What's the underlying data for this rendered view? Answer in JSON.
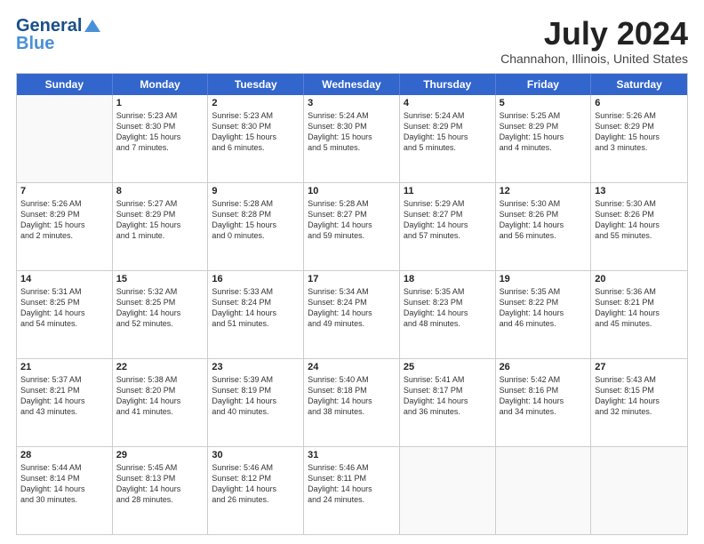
{
  "header": {
    "logo_line1": "General",
    "logo_line2": "Blue",
    "month": "July 2024",
    "location": "Channahon, Illinois, United States"
  },
  "days_of_week": [
    "Sunday",
    "Monday",
    "Tuesday",
    "Wednesday",
    "Thursday",
    "Friday",
    "Saturday"
  ],
  "weeks": [
    [
      {
        "day": "",
        "lines": []
      },
      {
        "day": "1",
        "lines": [
          "Sunrise: 5:23 AM",
          "Sunset: 8:30 PM",
          "Daylight: 15 hours",
          "and 7 minutes."
        ]
      },
      {
        "day": "2",
        "lines": [
          "Sunrise: 5:23 AM",
          "Sunset: 8:30 PM",
          "Daylight: 15 hours",
          "and 6 minutes."
        ]
      },
      {
        "day": "3",
        "lines": [
          "Sunrise: 5:24 AM",
          "Sunset: 8:30 PM",
          "Daylight: 15 hours",
          "and 5 minutes."
        ]
      },
      {
        "day": "4",
        "lines": [
          "Sunrise: 5:24 AM",
          "Sunset: 8:29 PM",
          "Daylight: 15 hours",
          "and 5 minutes."
        ]
      },
      {
        "day": "5",
        "lines": [
          "Sunrise: 5:25 AM",
          "Sunset: 8:29 PM",
          "Daylight: 15 hours",
          "and 4 minutes."
        ]
      },
      {
        "day": "6",
        "lines": [
          "Sunrise: 5:26 AM",
          "Sunset: 8:29 PM",
          "Daylight: 15 hours",
          "and 3 minutes."
        ]
      }
    ],
    [
      {
        "day": "7",
        "lines": [
          "Sunrise: 5:26 AM",
          "Sunset: 8:29 PM",
          "Daylight: 15 hours",
          "and 2 minutes."
        ]
      },
      {
        "day": "8",
        "lines": [
          "Sunrise: 5:27 AM",
          "Sunset: 8:29 PM",
          "Daylight: 15 hours",
          "and 1 minute."
        ]
      },
      {
        "day": "9",
        "lines": [
          "Sunrise: 5:28 AM",
          "Sunset: 8:28 PM",
          "Daylight: 15 hours",
          "and 0 minutes."
        ]
      },
      {
        "day": "10",
        "lines": [
          "Sunrise: 5:28 AM",
          "Sunset: 8:27 PM",
          "Daylight: 14 hours",
          "and 59 minutes."
        ]
      },
      {
        "day": "11",
        "lines": [
          "Sunrise: 5:29 AM",
          "Sunset: 8:27 PM",
          "Daylight: 14 hours",
          "and 57 minutes."
        ]
      },
      {
        "day": "12",
        "lines": [
          "Sunrise: 5:30 AM",
          "Sunset: 8:26 PM",
          "Daylight: 14 hours",
          "and 56 minutes."
        ]
      },
      {
        "day": "13",
        "lines": [
          "Sunrise: 5:30 AM",
          "Sunset: 8:26 PM",
          "Daylight: 14 hours",
          "and 55 minutes."
        ]
      }
    ],
    [
      {
        "day": "14",
        "lines": [
          "Sunrise: 5:31 AM",
          "Sunset: 8:25 PM",
          "Daylight: 14 hours",
          "and 54 minutes."
        ]
      },
      {
        "day": "15",
        "lines": [
          "Sunrise: 5:32 AM",
          "Sunset: 8:25 PM",
          "Daylight: 14 hours",
          "and 52 minutes."
        ]
      },
      {
        "day": "16",
        "lines": [
          "Sunrise: 5:33 AM",
          "Sunset: 8:24 PM",
          "Daylight: 14 hours",
          "and 51 minutes."
        ]
      },
      {
        "day": "17",
        "lines": [
          "Sunrise: 5:34 AM",
          "Sunset: 8:24 PM",
          "Daylight: 14 hours",
          "and 49 minutes."
        ]
      },
      {
        "day": "18",
        "lines": [
          "Sunrise: 5:35 AM",
          "Sunset: 8:23 PM",
          "Daylight: 14 hours",
          "and 48 minutes."
        ]
      },
      {
        "day": "19",
        "lines": [
          "Sunrise: 5:35 AM",
          "Sunset: 8:22 PM",
          "Daylight: 14 hours",
          "and 46 minutes."
        ]
      },
      {
        "day": "20",
        "lines": [
          "Sunrise: 5:36 AM",
          "Sunset: 8:21 PM",
          "Daylight: 14 hours",
          "and 45 minutes."
        ]
      }
    ],
    [
      {
        "day": "21",
        "lines": [
          "Sunrise: 5:37 AM",
          "Sunset: 8:21 PM",
          "Daylight: 14 hours",
          "and 43 minutes."
        ]
      },
      {
        "day": "22",
        "lines": [
          "Sunrise: 5:38 AM",
          "Sunset: 8:20 PM",
          "Daylight: 14 hours",
          "and 41 minutes."
        ]
      },
      {
        "day": "23",
        "lines": [
          "Sunrise: 5:39 AM",
          "Sunset: 8:19 PM",
          "Daylight: 14 hours",
          "and 40 minutes."
        ]
      },
      {
        "day": "24",
        "lines": [
          "Sunrise: 5:40 AM",
          "Sunset: 8:18 PM",
          "Daylight: 14 hours",
          "and 38 minutes."
        ]
      },
      {
        "day": "25",
        "lines": [
          "Sunrise: 5:41 AM",
          "Sunset: 8:17 PM",
          "Daylight: 14 hours",
          "and 36 minutes."
        ]
      },
      {
        "day": "26",
        "lines": [
          "Sunrise: 5:42 AM",
          "Sunset: 8:16 PM",
          "Daylight: 14 hours",
          "and 34 minutes."
        ]
      },
      {
        "day": "27",
        "lines": [
          "Sunrise: 5:43 AM",
          "Sunset: 8:15 PM",
          "Daylight: 14 hours",
          "and 32 minutes."
        ]
      }
    ],
    [
      {
        "day": "28",
        "lines": [
          "Sunrise: 5:44 AM",
          "Sunset: 8:14 PM",
          "Daylight: 14 hours",
          "and 30 minutes."
        ]
      },
      {
        "day": "29",
        "lines": [
          "Sunrise: 5:45 AM",
          "Sunset: 8:13 PM",
          "Daylight: 14 hours",
          "and 28 minutes."
        ]
      },
      {
        "day": "30",
        "lines": [
          "Sunrise: 5:46 AM",
          "Sunset: 8:12 PM",
          "Daylight: 14 hours",
          "and 26 minutes."
        ]
      },
      {
        "day": "31",
        "lines": [
          "Sunrise: 5:46 AM",
          "Sunset: 8:11 PM",
          "Daylight: 14 hours",
          "and 24 minutes."
        ]
      },
      {
        "day": "",
        "lines": []
      },
      {
        "day": "",
        "lines": []
      },
      {
        "day": "",
        "lines": []
      }
    ]
  ]
}
